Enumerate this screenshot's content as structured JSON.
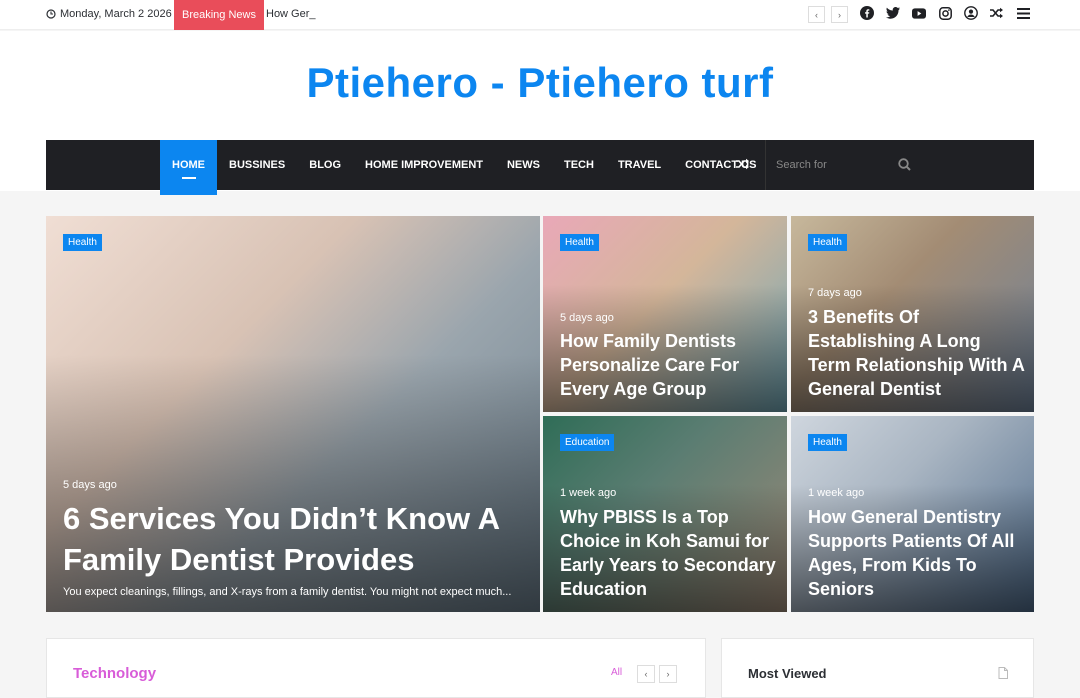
{
  "topbar": {
    "date": "Monday, March 2 2026",
    "breaking_label": "Breaking News",
    "ticker": "How Ger_",
    "prev": "‹",
    "next": "›"
  },
  "header": {
    "logo": "Ptiehero - Ptiehero turf"
  },
  "nav": {
    "items": [
      "HOME",
      "BUSSINES",
      "BLOG",
      "HOME IMPROVEMENT",
      "NEWS",
      "TECH",
      "TRAVEL",
      "CONTACT US"
    ],
    "search_placeholder": "Search for"
  },
  "featured": {
    "main": {
      "category": "Health",
      "time": "5 days ago",
      "title": "6 Services You Didn’t Know A Family Dentist Provides",
      "excerpt": "You expect cleanings, fillings, and X-rays from a family dentist. You might not expect much..."
    },
    "cards": [
      {
        "category": "Health",
        "time": "5 days ago",
        "title": "How Family Dentists Personalize Care For Every Age Group"
      },
      {
        "category": "Health",
        "time": "7 days ago",
        "title": "3 Benefits Of Establishing A Long Term Relationship With A General Dentist"
      },
      {
        "category": "Education",
        "time": "1 week ago",
        "title": "Why PBISS Is a Top Choice in Koh Samui for Early Years to Secondary Education"
      },
      {
        "category": "Health",
        "time": "1 week ago",
        "title": "How General Dentistry Supports Patients Of All Ages, From Kids To Seniors"
      }
    ]
  },
  "widgets": {
    "technology": {
      "title": "Technology",
      "all": "All"
    },
    "most_viewed": {
      "title": "Most Viewed"
    }
  },
  "colors": {
    "accent": "#0c86f0",
    "breaking": "#e94d5a",
    "nav_bg": "#1f2024",
    "technology": "#d85cd8"
  }
}
